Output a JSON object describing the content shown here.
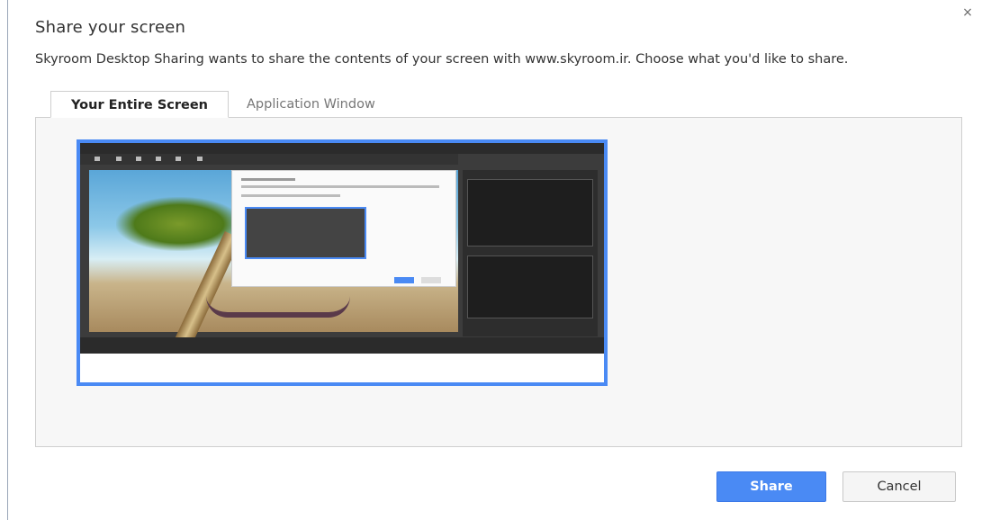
{
  "dialog": {
    "title": "Share your screen",
    "close_glyph": "×",
    "description": "Skyroom Desktop Sharing wants to share the contents of your screen with www.skyroom.ir. Choose what you'd like to share."
  },
  "tabs": [
    {
      "label": "Your Entire Screen",
      "active": true
    },
    {
      "label": "Application Window",
      "active": false
    }
  ],
  "buttons": {
    "share_label": "Share",
    "cancel_label": "Cancel"
  },
  "colors": {
    "accent": "#4a8af4",
    "panel_bg": "#f7f7f7"
  },
  "icons": {
    "close": "close-icon"
  }
}
